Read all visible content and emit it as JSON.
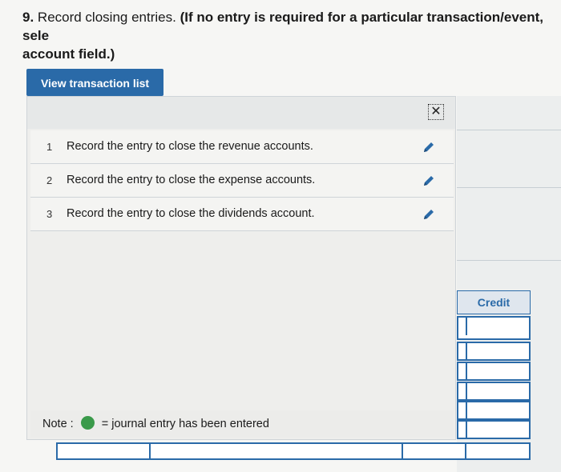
{
  "question": {
    "number": "9.",
    "text": " Record closing entries. ",
    "instruction": "(If no entry is required for a particular transaction/event, select \"No Journal Entry Required\" in the first account field.)",
    "instruction_visible_line1": "(If no entry is required for a particular transaction/event, sele",
    "instruction_visible_line2": "account field.)"
  },
  "view_button": {
    "label": "View transaction list"
  },
  "panel": {
    "close_icon": "close-icon",
    "rows": [
      {
        "num": "1",
        "label": "Record the entry to close the revenue accounts.",
        "icon": "pencil-icon"
      },
      {
        "num": "2",
        "label": "Record the entry to close the expense accounts.",
        "icon": "pencil-icon"
      },
      {
        "num": "3",
        "label": "Record the entry to close the dividends account.",
        "icon": "pencil-icon"
      }
    ],
    "note": {
      "prefix": "Note :",
      "text": "= journal entry has been entered",
      "dot_color": "#3a9a4a"
    }
  },
  "journal": {
    "credit_header": "Credit"
  },
  "colors": {
    "accent": "#2a6aa8"
  }
}
